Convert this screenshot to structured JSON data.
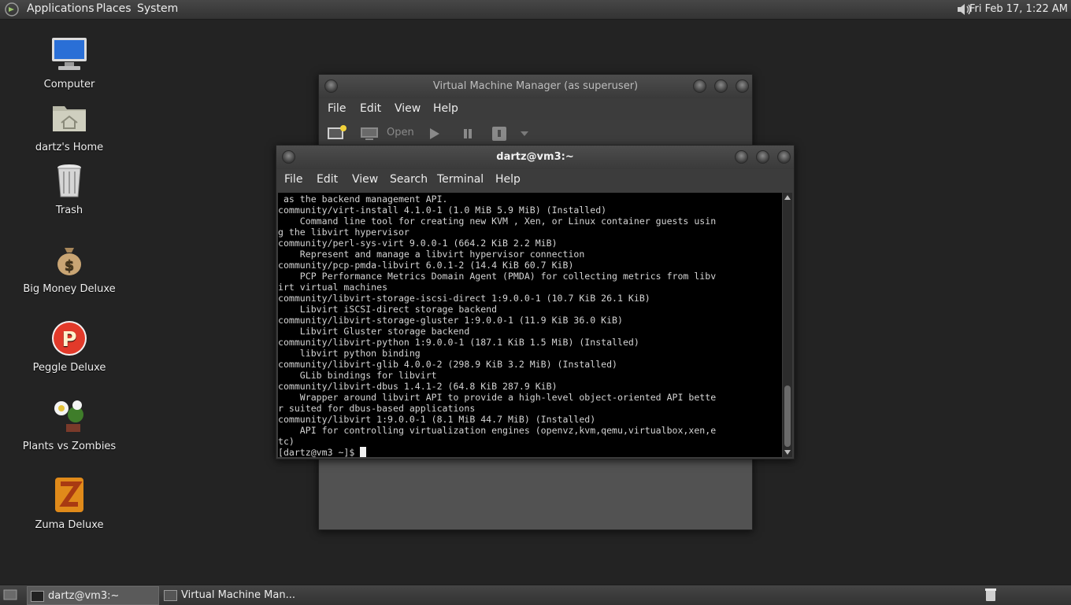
{
  "top_panel": {
    "menus": [
      "Applications",
      "Places",
      "System"
    ],
    "clock": "Fri Feb 17,  1:22 AM"
  },
  "desktop_icons": [
    {
      "label": "Computer",
      "icon": "computer-icon"
    },
    {
      "label": "dartz's Home",
      "icon": "home-folder-icon"
    },
    {
      "label": "Trash",
      "icon": "trash-icon"
    },
    {
      "label": "Big Money Deluxe",
      "icon": "money-bag-icon"
    },
    {
      "label": "Peggle Deluxe",
      "icon": "peggle-icon"
    },
    {
      "label": "Plants vs Zombies",
      "icon": "plants-icon"
    },
    {
      "label": "Zuma Deluxe",
      "icon": "zuma-icon"
    }
  ],
  "vmm_window": {
    "title": "Virtual Machine Manager (as superuser)",
    "menus": [
      "File",
      "Edit",
      "View",
      "Help"
    ],
    "toolbar": {
      "open_label": "Open"
    }
  },
  "terminal_window": {
    "title": "dartz@vm3:~",
    "menus": [
      "File",
      "Edit",
      "View",
      "Search",
      "Terminal",
      "Help"
    ],
    "lines": [
      " as the backend management API.",
      "community/virt-install 4.1.0-1 (1.0 MiB 5.9 MiB) (Installed)",
      "    Command line tool for creating new KVM , Xen, or Linux container guests usin",
      "g the libvirt hypervisor",
      "community/perl-sys-virt 9.0.0-1 (664.2 KiB 2.2 MiB)",
      "    Represent and manage a libvirt hypervisor connection",
      "community/pcp-pmda-libvirt 6.0.1-2 (14.4 KiB 60.7 KiB)",
      "    PCP Performance Metrics Domain Agent (PMDA) for collecting metrics from libv",
      "irt virtual machines",
      "community/libvirt-storage-iscsi-direct 1:9.0.0-1 (10.7 KiB 26.1 KiB)",
      "    Libvirt iSCSI-direct storage backend",
      "community/libvirt-storage-gluster 1:9.0.0-1 (11.9 KiB 36.0 KiB)",
      "    Libvirt Gluster storage backend",
      "community/libvirt-python 1:9.0.0-1 (187.1 KiB 1.5 MiB) (Installed)",
      "    libvirt python binding",
      "community/libvirt-glib 4.0.0-2 (298.9 KiB 3.2 MiB) (Installed)",
      "    GLib bindings for libvirt",
      "community/libvirt-dbus 1.4.1-2 (64.8 KiB 287.9 KiB)",
      "    Wrapper around libvirt API to provide a high-level object-oriented API bette",
      "r suited for dbus-based applications",
      "community/libvirt 1:9.0.0-1 (8.1 MiB 44.7 MiB) (Installed)",
      "    API for controlling virtualization engines (openvz,kvm,qemu,virtualbox,xen,e",
      "tc)"
    ],
    "prompt": "[dartz@vm3 ~]$ "
  },
  "taskbar": {
    "tasks": [
      "dartz@vm3:~",
      "Virtual Machine Man..."
    ]
  }
}
